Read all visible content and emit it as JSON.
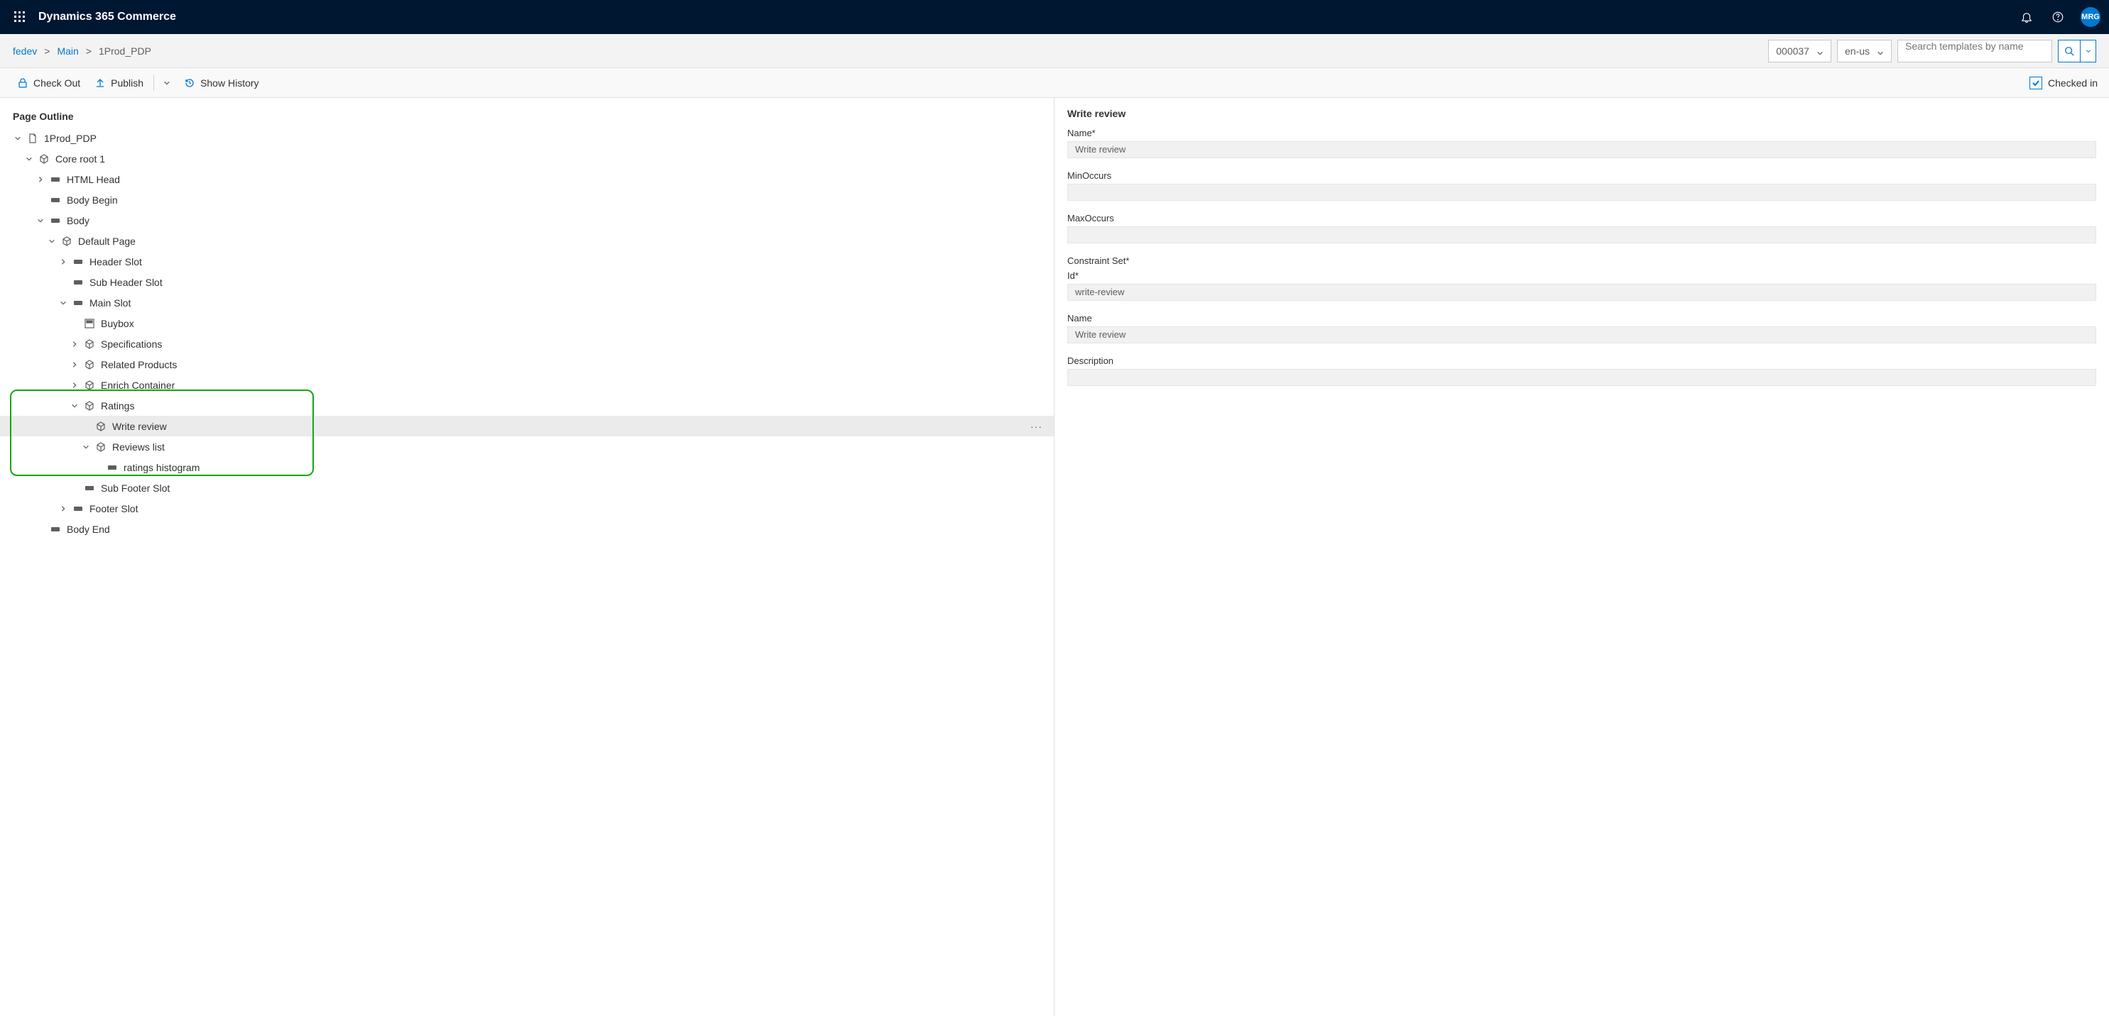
{
  "header": {
    "app_title": "Dynamics 365 Commerce",
    "avatar_initials": "MRG"
  },
  "breadcrumb": {
    "items": [
      "fedev",
      "Main",
      "1Prod_PDP"
    ],
    "site_selector": "000037",
    "locale_selector": "en-us",
    "search_placeholder": "Search templates by name"
  },
  "commandbar": {
    "check_out": "Check Out",
    "publish": "Publish",
    "show_history": "Show History",
    "checked_in": "Checked in"
  },
  "outline": {
    "heading": "Page Outline",
    "root_label": "1Prod_PDP",
    "core_root": "Core root 1",
    "html_head": "HTML Head",
    "body_begin": "Body Begin",
    "body": "Body",
    "default_page": "Default Page",
    "header_slot": "Header Slot",
    "sub_header_slot": "Sub Header Slot",
    "main_slot": "Main Slot",
    "buybox": "Buybox",
    "specifications": "Specifications",
    "related_products": "Related Products",
    "enrich_container": "Enrich Container",
    "ratings": "Ratings",
    "write_review": "Write review",
    "reviews_list": "Reviews list",
    "ratings_histogram": "ratings histogram",
    "sub_footer_slot": "Sub Footer Slot",
    "footer_slot": "Footer Slot",
    "body_end": "Body End"
  },
  "properties": {
    "title": "Write review",
    "name_label": "Name*",
    "name_value": "Write review",
    "min_occurs_label": "MinOccurs",
    "min_occurs_value": "",
    "max_occurs_label": "MaxOccurs",
    "max_occurs_value": "",
    "constraint_set_label": "Constraint Set*",
    "id_label": "Id*",
    "id_value": "write-review",
    "name2_label": "Name",
    "name2_value": "Write review",
    "description_label": "Description",
    "description_value": ""
  }
}
